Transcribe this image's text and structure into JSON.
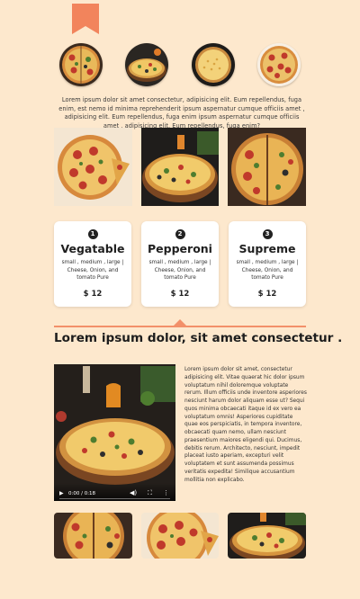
{
  "intro_text": "Lorem ipsum dolor sit amet consectetur, adipisicing elit. Eum repellendus, fuga enim, est nemo id minima reprehenderit ipsum aspernatur cumque officiis amet , adipisicing elit. Eum repellendus, fuga enim ipsum aspernatur cumque officiis amet , adipisicing elit. Eum repellendus, fuga enim?",
  "cards": [
    {
      "number": "1",
      "name": "Vegatable",
      "desc": "small , medium , large | Cheese, Onion, and tomato Pure",
      "price": "$ 12"
    },
    {
      "number": "2",
      "name": "Pepperoni",
      "desc": "small , medium , large | Cheese, Onion, and tomato Pure",
      "price": "$ 12"
    },
    {
      "number": "3",
      "name": "Supreme",
      "desc": "small , medium , large | Cheese, Onion, and tomato Pure",
      "price": "$ 12"
    }
  ],
  "section_heading": "Lorem ipsum dolor, sit amet consectetur .",
  "video": {
    "time": "0:00 / 0:18"
  },
  "body_text": "Lorem ipsum dolor sit amet, consectetur adipisicing elit. Vitae quaerat hic dolor ipsum voluptatum nihil doloremque voluptate rerum. Illum officiis unde inventore asperiores nesciunt harum dolor aliquam esse ut? Sequi quos minima obcaecati itaque id ex vero ea voluptatum omnis! Asperiores cupiditate quae eos perspiciatis, in tempora inventore, obcaecati quam nemo, ullam nesciunt praesentium maiores eligendi qui. Ducimus, debitis rerum. Architecto, nesciunt, impedit placeat iusto aperiam, excepturi velit voluptatem et sunt assumenda possimus veritatis expedita! Similique accusantium mollitia non explicabo.",
  "colors": {
    "background": "#fde8cd",
    "accent": "#f2906a",
    "card": "#ffffff"
  }
}
